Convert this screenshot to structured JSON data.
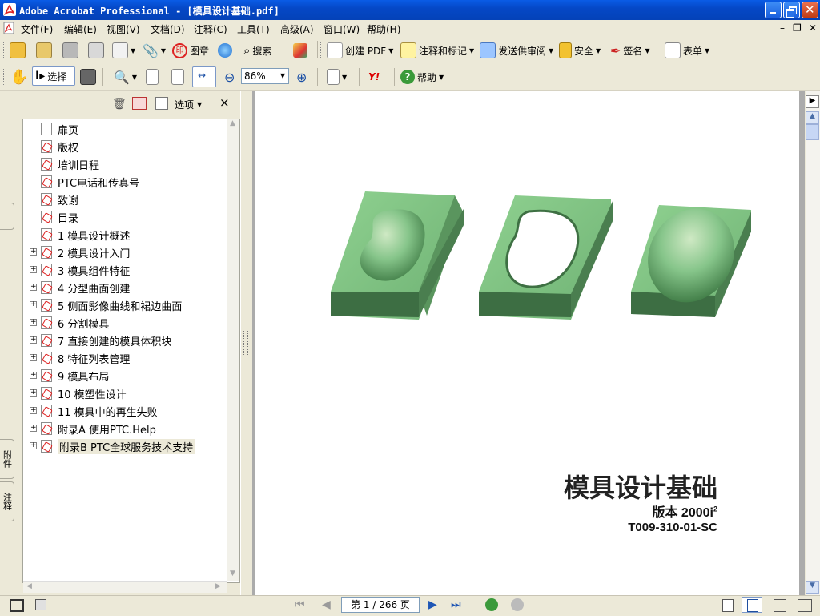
{
  "window": {
    "title": "Adobe Acrobat Professional - [模具设计基础.pdf]",
    "minimize": "_",
    "restore": "❐",
    "close": "✕"
  },
  "menu": {
    "items": [
      "文件(F)",
      "编辑(E)",
      "视图(V)",
      "文档(D)",
      "注释(C)",
      "工具(T)",
      "高级(A)",
      "窗口(W)",
      "帮助(H)"
    ],
    "doc_controls": [
      "–",
      "❐",
      "✕"
    ]
  },
  "toolbar1": {
    "seal": "图章",
    "search": "搜索",
    "create_pdf": "创建 PDF",
    "comment": "注释和标记",
    "send_review": "发送供审阅",
    "security": "安全",
    "sign": "签名",
    "forms": "表单"
  },
  "toolbar2": {
    "select": "选择",
    "zoom_value": "86%",
    "yahoo": "Y!",
    "help": "帮助"
  },
  "panel": {
    "options": "选项",
    "close": "×",
    "tabs": [
      "附件",
      "注释"
    ]
  },
  "bookmarks": [
    {
      "label": "扉页",
      "expandable": false,
      "plain": true
    },
    {
      "label": "版权",
      "expandable": false
    },
    {
      "label": "培训日程",
      "expandable": false
    },
    {
      "label": "PTC电话和传真号",
      "expandable": false
    },
    {
      "label": "致谢",
      "expandable": false
    },
    {
      "label": "目录",
      "expandable": false
    },
    {
      "label": "1 模具设计概述",
      "expandable": false
    },
    {
      "label": "2 模具设计入门",
      "expandable": true
    },
    {
      "label": "3 模具组件特征",
      "expandable": true
    },
    {
      "label": "4 分型曲面创建",
      "expandable": true
    },
    {
      "label": "5 侧面影像曲线和裙边曲面",
      "expandable": true
    },
    {
      "label": "6 分割模具",
      "expandable": true
    },
    {
      "label": "7 直接创建的模具体积块",
      "expandable": true
    },
    {
      "label": "8 特征列表管理",
      "expandable": true
    },
    {
      "label": "9 模具布局",
      "expandable": true
    },
    {
      "label": "10 模塑性设计",
      "expandable": true
    },
    {
      "label": "11 模具中的再生失败",
      "expandable": true
    },
    {
      "label": "附录A 使用PTC.Help",
      "expandable": true
    },
    {
      "label": "附录B PTC全球服务技术支持",
      "expandable": true,
      "selected": true
    }
  ],
  "document": {
    "title": "模具设计基础",
    "version": "版本 2000i",
    "version_sup": "2",
    "code": "T009-310-01-SC"
  },
  "status": {
    "page_display": "第 1 / 266 页"
  },
  "colors": {
    "titlebar": "#0548c7",
    "mold_green": "#7fbf7f",
    "pdf_red": "#d22222"
  }
}
